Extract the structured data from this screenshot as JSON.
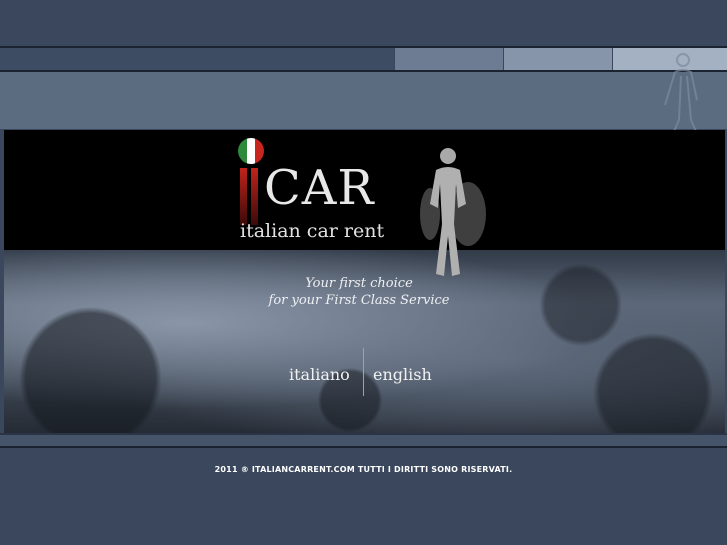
{
  "logo": {
    "wordmark": "CAR",
    "subtitle": "italian car rent",
    "flag_colors": [
      "#2d8a3a",
      "#ffffff",
      "#c8251f"
    ]
  },
  "tagline": {
    "line1": "Your first choice",
    "line2": "for your First Class Service"
  },
  "languages": [
    {
      "label": "italiano"
    },
    {
      "label": "english"
    }
  ],
  "footer": {
    "text": "2011 ® ITALIANCARRENT.COM TUTTI I DIRITTI SONO RISERVATI."
  },
  "colors": {
    "background": "#3a475c",
    "hero": "#000000",
    "text": "#ffffff"
  }
}
